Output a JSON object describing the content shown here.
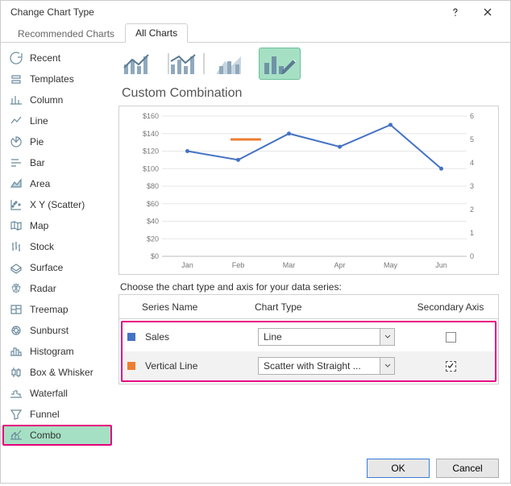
{
  "window": {
    "title": "Change Chart Type"
  },
  "tabs": {
    "recommended": "Recommended Charts",
    "all": "All Charts",
    "active": "all"
  },
  "sidebar": {
    "items": [
      {
        "label": "Recent"
      },
      {
        "label": "Templates"
      },
      {
        "label": "Column"
      },
      {
        "label": "Line"
      },
      {
        "label": "Pie"
      },
      {
        "label": "Bar"
      },
      {
        "label": "Area"
      },
      {
        "label": "X Y (Scatter)"
      },
      {
        "label": "Map"
      },
      {
        "label": "Stock"
      },
      {
        "label": "Surface"
      },
      {
        "label": "Radar"
      },
      {
        "label": "Treemap"
      },
      {
        "label": "Sunburst"
      },
      {
        "label": "Histogram"
      },
      {
        "label": "Box & Whisker"
      },
      {
        "label": "Waterfall"
      },
      {
        "label": "Funnel"
      },
      {
        "label": "Combo"
      }
    ],
    "selected": "Combo"
  },
  "main": {
    "subtypes": [
      "clustered-column-line",
      "clustered-column-line-secondary",
      "stacked-area-column",
      "custom-combination"
    ],
    "subtype_selected": 3,
    "section_title": "Custom Combination",
    "series_header": "Choose the chart type and axis for your data series:",
    "columns": {
      "series": "Series Name",
      "chart_type": "Chart Type",
      "secondary": "Secondary Axis"
    },
    "series": [
      {
        "name": "Sales",
        "color": "#4472c4",
        "chart_type": "Line",
        "secondary": false,
        "dashed_focus": false
      },
      {
        "name": "Vertical Line",
        "color": "#ed7d31",
        "chart_type": "Scatter with Straight ...",
        "secondary": true,
        "dashed_focus": true
      }
    ]
  },
  "chart_data": {
    "type": "line",
    "title": "",
    "xlabel": "",
    "ylabel": "",
    "categories": [
      "Jan",
      "Feb",
      "Mar",
      "Apr",
      "May",
      "Jun"
    ],
    "series": [
      {
        "name": "Sales",
        "axis": "primary",
        "values": [
          120,
          110,
          140,
          125,
          150,
          100
        ],
        "color": "#4472c4"
      }
    ],
    "secondary_series": [
      {
        "name": "Vertical Line",
        "axis": "secondary",
        "type": "segment",
        "x": [
          1.35,
          1.95
        ],
        "y": [
          5,
          5
        ],
        "color": "#ed7d31"
      }
    ],
    "y_primary": {
      "min": 0,
      "max": 160,
      "step": 20,
      "format": "${v}"
    },
    "y_secondary": {
      "min": 0,
      "max": 6,
      "step": 1
    }
  },
  "footer": {
    "ok": "OK",
    "cancel": "Cancel"
  },
  "icons": {
    "help": "?",
    "close": "×"
  }
}
